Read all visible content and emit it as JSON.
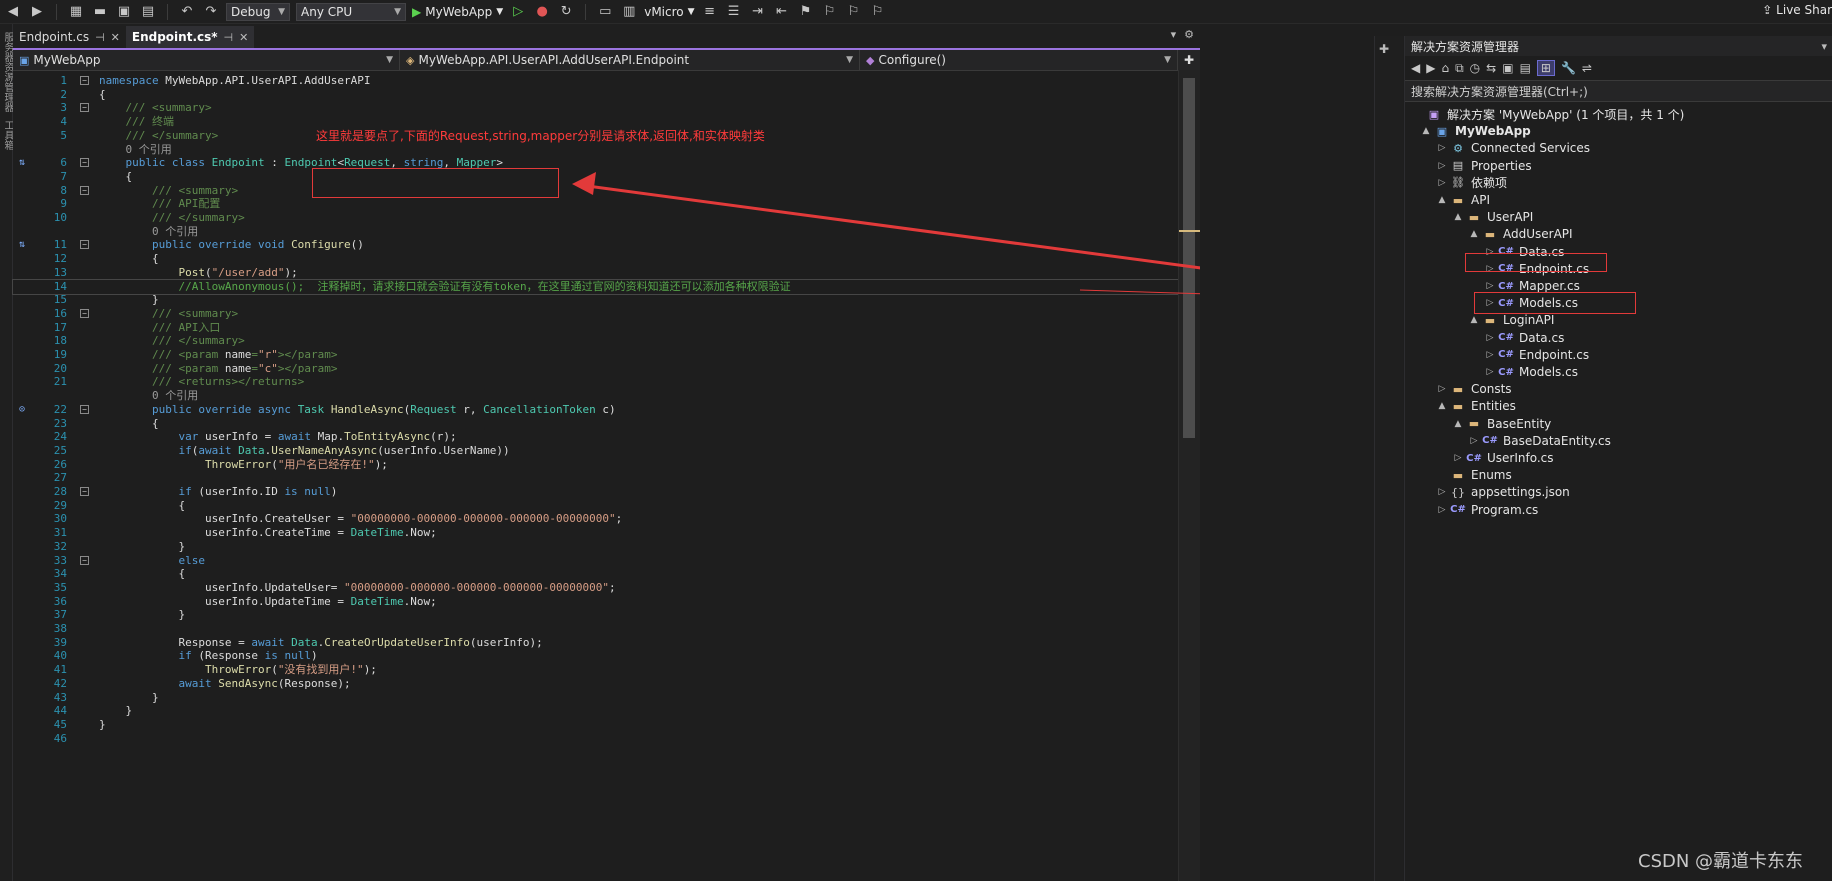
{
  "toolbar": {
    "config": "Debug",
    "platform": "Any CPU",
    "run_target": "MyWebApp",
    "device": "vMicro",
    "live_share": "Live Shar"
  },
  "left_strip": [
    "服务器资源管理器",
    "工具箱"
  ],
  "editor": {
    "tabs": [
      {
        "label": "Endpoint.cs",
        "active": false
      },
      {
        "label": "Endpoint.cs*",
        "active": true
      }
    ],
    "nav": {
      "project": "MyWebApp",
      "type": "MyWebApp.API.UserAPI.AddUserAPI.Endpoint",
      "member": "Configure()"
    },
    "lines": [
      {
        "n": "1",
        "seg": [
          [
            "kw",
            "namespace"
          ],
          [
            "pl",
            " MyWebApp.API.UserAPI.AddUserAPI"
          ]
        ]
      },
      {
        "n": "2",
        "seg": [
          [
            "pl",
            "{"
          ]
        ]
      },
      {
        "n": "3",
        "seg": [
          [
            "xml",
            "    /// "
          ],
          [
            "xml",
            "<summary>"
          ]
        ]
      },
      {
        "n": "4",
        "seg": [
          [
            "xml",
            "    /// 终端"
          ]
        ]
      },
      {
        "n": "5",
        "seg": [
          [
            "xml",
            "    /// </summary>"
          ]
        ]
      },
      {
        "n": "",
        "seg": [
          [
            "ref",
            "    0 个引用"
          ]
        ]
      },
      {
        "n": "6",
        "seg": [
          [
            "kw",
            "    public class "
          ],
          [
            "ty",
            "Endpoint"
          ],
          [
            "pl",
            " : "
          ],
          [
            "ty",
            "Endpoint"
          ],
          [
            "pl",
            "<"
          ],
          [
            "ty",
            "Request"
          ],
          [
            "pl",
            ", "
          ],
          [
            "kw",
            "string"
          ],
          [
            "pl",
            ", "
          ],
          [
            "ty",
            "Mapper"
          ],
          [
            "pl",
            ">"
          ]
        ]
      },
      {
        "n": "7",
        "seg": [
          [
            "pl",
            "    {"
          ]
        ]
      },
      {
        "n": "8",
        "seg": [
          [
            "xml",
            "        /// <summary>"
          ]
        ]
      },
      {
        "n": "9",
        "seg": [
          [
            "xml",
            "        /// API配置"
          ]
        ]
      },
      {
        "n": "10",
        "seg": [
          [
            "xml",
            "        /// </summary>"
          ]
        ]
      },
      {
        "n": "",
        "seg": [
          [
            "ref",
            "        0 个引用"
          ]
        ]
      },
      {
        "n": "11",
        "seg": [
          [
            "kw",
            "        public override void "
          ],
          [
            "mt",
            "Configure"
          ],
          [
            "pl",
            "()"
          ]
        ]
      },
      {
        "n": "12",
        "seg": [
          [
            "pl",
            "        {"
          ]
        ]
      },
      {
        "n": "13",
        "seg": [
          [
            "mt",
            "            Post"
          ],
          [
            "pl",
            "("
          ],
          [
            "st",
            "\"/user/add\""
          ],
          [
            "pl",
            ");"
          ]
        ]
      },
      {
        "n": "14",
        "seg": [
          [
            "cm",
            "            //AllowAnonymous();  注释掉时，请求接口就会验证有没有token，在这里通过官网的资料知道还可以添加各种权限验证"
          ]
        ]
      },
      {
        "n": "15",
        "seg": [
          [
            "pl",
            "        }"
          ]
        ]
      },
      {
        "n": "16",
        "seg": [
          [
            "xml",
            "        /// <summary>"
          ]
        ]
      },
      {
        "n": "17",
        "seg": [
          [
            "xml",
            "        /// API入口"
          ]
        ]
      },
      {
        "n": "18",
        "seg": [
          [
            "xml",
            "        /// </summary>"
          ]
        ]
      },
      {
        "n": "19",
        "seg": [
          [
            "xml",
            "        /// <param "
          ],
          [
            "pl",
            "name"
          ],
          [
            "xml",
            "="
          ],
          [
            "st",
            "\"r\""
          ],
          [
            "xml",
            "></param>"
          ]
        ]
      },
      {
        "n": "20",
        "seg": [
          [
            "xml",
            "        /// <param "
          ],
          [
            "pl",
            "name"
          ],
          [
            "xml",
            "="
          ],
          [
            "st",
            "\"c\""
          ],
          [
            "xml",
            "></param>"
          ]
        ]
      },
      {
        "n": "21",
        "seg": [
          [
            "xml",
            "        /// <returns></returns>"
          ]
        ]
      },
      {
        "n": "",
        "seg": [
          [
            "ref",
            "        0 个引用"
          ]
        ]
      },
      {
        "n": "22",
        "seg": [
          [
            "kw",
            "        public override async "
          ],
          [
            "ty",
            "Task"
          ],
          [
            "pl",
            " "
          ],
          [
            "mt",
            "HandleAsync"
          ],
          [
            "pl",
            "("
          ],
          [
            "ty",
            "Request"
          ],
          [
            "pl",
            " r, "
          ],
          [
            "ty",
            "CancellationToken"
          ],
          [
            "pl",
            " c)"
          ]
        ]
      },
      {
        "n": "23",
        "seg": [
          [
            "pl",
            "        {"
          ]
        ]
      },
      {
        "n": "24",
        "seg": [
          [
            "kw",
            "            var "
          ],
          [
            "pl",
            "userInfo = "
          ],
          [
            "kw",
            "await "
          ],
          [
            "pl",
            "Map."
          ],
          [
            "mt",
            "ToEntityAsync"
          ],
          [
            "pl",
            "(r);"
          ]
        ]
      },
      {
        "n": "25",
        "seg": [
          [
            "kw",
            "            if"
          ],
          [
            "pl",
            "("
          ],
          [
            "kw",
            "await "
          ],
          [
            "ty",
            "Data"
          ],
          [
            "pl",
            "."
          ],
          [
            "mt",
            "UserNameAnyAsync"
          ],
          [
            "pl",
            "(userInfo.UserName))"
          ]
        ]
      },
      {
        "n": "26",
        "seg": [
          [
            "mt",
            "                ThrowError"
          ],
          [
            "pl",
            "("
          ],
          [
            "st",
            "\"用户名已经存在!\""
          ],
          [
            "pl",
            ");"
          ]
        ]
      },
      {
        "n": "27",
        "seg": [
          [
            "pl",
            ""
          ]
        ]
      },
      {
        "n": "28",
        "seg": [
          [
            "kw",
            "            if "
          ],
          [
            "pl",
            "(userInfo.ID "
          ],
          [
            "kw",
            "is null"
          ],
          [
            "pl",
            ")"
          ]
        ]
      },
      {
        "n": "29",
        "seg": [
          [
            "pl",
            "            {"
          ]
        ]
      },
      {
        "n": "30",
        "seg": [
          [
            "pl",
            "                userInfo.CreateUser = "
          ],
          [
            "st",
            "\"00000000-000000-000000-000000-00000000\""
          ],
          [
            "pl",
            ";"
          ]
        ]
      },
      {
        "n": "31",
        "seg": [
          [
            "pl",
            "                userInfo.CreateTime = "
          ],
          [
            "ty",
            "DateTime"
          ],
          [
            "pl",
            ".Now;"
          ]
        ]
      },
      {
        "n": "32",
        "seg": [
          [
            "pl",
            "            }"
          ]
        ]
      },
      {
        "n": "33",
        "seg": [
          [
            "kw",
            "            else"
          ]
        ]
      },
      {
        "n": "34",
        "seg": [
          [
            "pl",
            "            {"
          ]
        ]
      },
      {
        "n": "35",
        "seg": [
          [
            "pl",
            "                userInfo.UpdateUser= "
          ],
          [
            "st",
            "\"00000000-000000-000000-000000-00000000\""
          ],
          [
            "pl",
            ";"
          ]
        ]
      },
      {
        "n": "36",
        "seg": [
          [
            "pl",
            "                userInfo.UpdateTime = "
          ],
          [
            "ty",
            "DateTime"
          ],
          [
            "pl",
            ".Now;"
          ]
        ]
      },
      {
        "n": "37",
        "seg": [
          [
            "pl",
            "            }"
          ]
        ]
      },
      {
        "n": "38",
        "seg": [
          [
            "pl",
            ""
          ]
        ]
      },
      {
        "n": "39",
        "seg": [
          [
            "pl",
            "            Response = "
          ],
          [
            "kw",
            "await "
          ],
          [
            "ty",
            "Data"
          ],
          [
            "pl",
            "."
          ],
          [
            "mt",
            "CreateOrUpdateUserInfo"
          ],
          [
            "pl",
            "(userInfo);"
          ]
        ]
      },
      {
        "n": "40",
        "seg": [
          [
            "kw",
            "            if "
          ],
          [
            "pl",
            "(Response "
          ],
          [
            "kw",
            "is null"
          ],
          [
            "pl",
            ")"
          ]
        ]
      },
      {
        "n": "41",
        "seg": [
          [
            "mt",
            "                ThrowError"
          ],
          [
            "pl",
            "("
          ],
          [
            "st",
            "\"没有找到用户!\""
          ],
          [
            "pl",
            ");"
          ]
        ]
      },
      {
        "n": "42",
        "seg": [
          [
            "kw",
            "            await "
          ],
          [
            "mt",
            "SendAsync"
          ],
          [
            "pl",
            "(Response);"
          ]
        ]
      },
      {
        "n": "43",
        "seg": [
          [
            "pl",
            "        }"
          ]
        ]
      },
      {
        "n": "44",
        "seg": [
          [
            "pl",
            "    }"
          ]
        ]
      },
      {
        "n": "45",
        "seg": [
          [
            "pl",
            "}"
          ]
        ]
      },
      {
        "n": "46",
        "seg": [
          [
            "pl",
            ""
          ]
        ]
      }
    ]
  },
  "annotation": {
    "text": "这里就是要点了,下面的Request,string,mapper分别是请求体,返回体,和实体映射类",
    "color": "#ff3b3b"
  },
  "solution_explorer": {
    "title": "解决方案资源管理器",
    "search_placeholder": "搜索解决方案资源管理器(Ctrl+;)",
    "items": [
      {
        "label": "解决方案 'MyWebApp' (1 个项目，共 1 个)",
        "icon": "solution-icon",
        "exp": ""
      },
      {
        "label": "MyWebApp",
        "icon": "csharp-project-icon",
        "exp": "▲",
        "bold": true
      },
      {
        "label": "Connected Services",
        "icon": "connected-services-icon",
        "exp": "▷"
      },
      {
        "label": "Properties",
        "icon": "properties-icon",
        "exp": "▷"
      },
      {
        "label": "依赖项",
        "icon": "dependencies-icon",
        "exp": "▷"
      },
      {
        "label": "API",
        "icon": "folder-icon",
        "exp": "▲"
      },
      {
        "label": "UserAPI",
        "icon": "folder-icon",
        "exp": "▲"
      },
      {
        "label": "AddUserAPI",
        "icon": "folder-icon",
        "exp": "▲"
      },
      {
        "label": "Data.cs",
        "icon": "csharp-file-icon",
        "exp": "▷"
      },
      {
        "label": "Endpoint.cs",
        "icon": "csharp-file-icon",
        "exp": "▷"
      },
      {
        "label": "Mapper.cs",
        "icon": "csharp-file-icon",
        "exp": "▷"
      },
      {
        "label": "Models.cs",
        "icon": "csharp-file-icon",
        "exp": "▷"
      },
      {
        "label": "LoginAPI",
        "icon": "folder-icon",
        "exp": "▲"
      },
      {
        "label": "Data.cs",
        "icon": "csharp-file-icon",
        "exp": "▷"
      },
      {
        "label": "Endpoint.cs",
        "icon": "csharp-file-icon",
        "exp": "▷"
      },
      {
        "label": "Models.cs",
        "icon": "csharp-file-icon",
        "exp": "▷"
      },
      {
        "label": "Consts",
        "icon": "folder-icon",
        "exp": "▷"
      },
      {
        "label": "Entities",
        "icon": "folder-icon",
        "exp": "▲"
      },
      {
        "label": "BaseEntity",
        "icon": "folder-icon",
        "exp": "▲"
      },
      {
        "label": "BaseDataEntity.cs",
        "icon": "csharp-file-icon",
        "exp": "▷"
      },
      {
        "label": "UserInfo.cs",
        "icon": "csharp-file-icon",
        "exp": "▷"
      },
      {
        "label": "Enums",
        "icon": "folder-icon",
        "exp": ""
      },
      {
        "label": "appsettings.json",
        "icon": "json-file-icon",
        "exp": "▷"
      },
      {
        "label": "Program.cs",
        "icon": "csharp-file-icon",
        "exp": "▷"
      }
    ]
  },
  "watermark": "CSDN @霸道卡东东",
  "colors": {
    "accent": "#9b74df",
    "annotation": "#e23a3a",
    "keyword": "#569cd6",
    "type": "#4ec9b0",
    "comment": "#57a64a"
  }
}
